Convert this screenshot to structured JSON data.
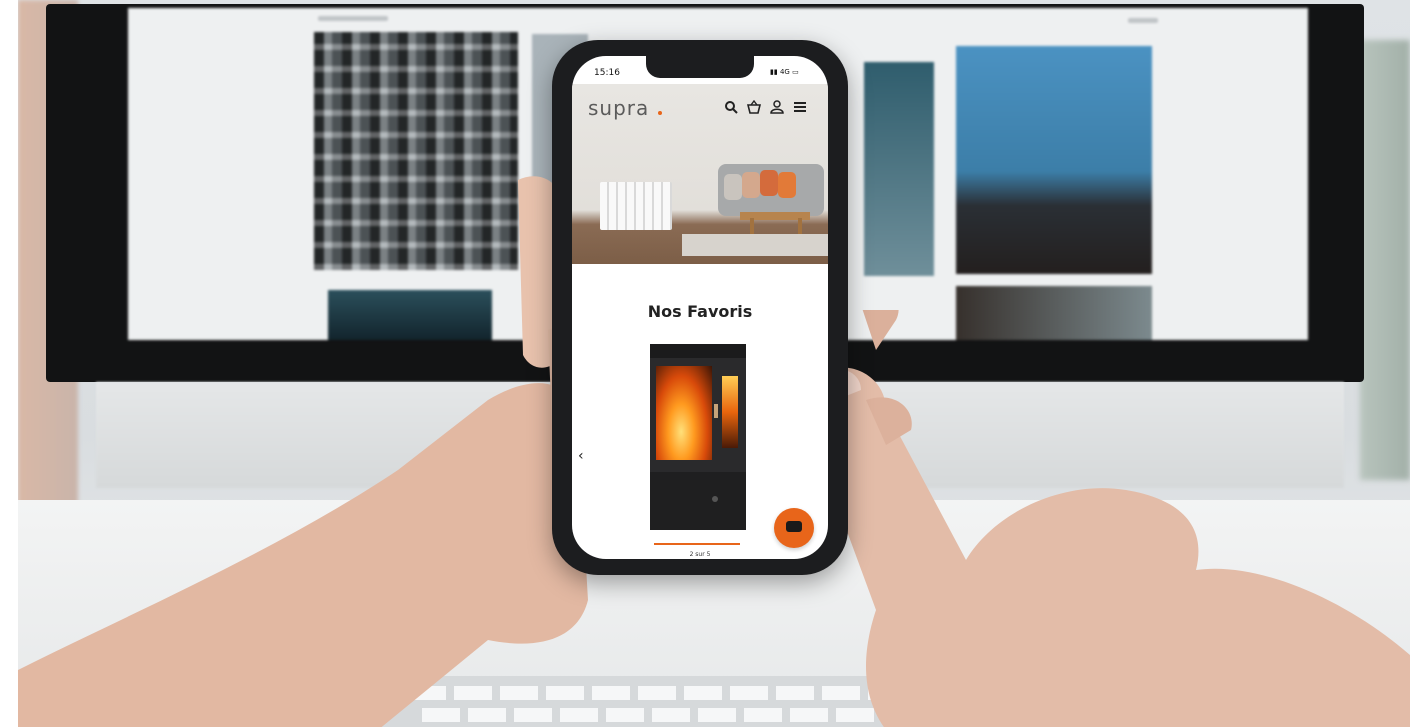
{
  "phone": {
    "status_time": "15:16",
    "status_signal": "4G",
    "brand": "supra",
    "nav_icons": [
      "search-icon",
      "basket-icon",
      "account-icon",
      "menu-icon"
    ],
    "section_title": "Nos Favoris",
    "prev_arrow": "‹",
    "pager_text": "2 sur 5",
    "accent_color": "#e8651a"
  }
}
